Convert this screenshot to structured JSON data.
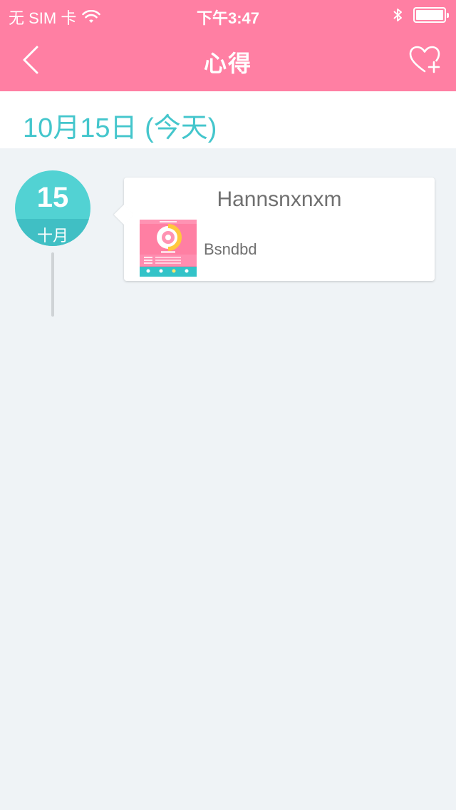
{
  "status": {
    "carrier": "无 SIM 卡",
    "time": "下午3:47"
  },
  "nav": {
    "title": "心得",
    "back_icon": "chevron-left-icon",
    "action_icon": "heart-plus-icon"
  },
  "date_header": {
    "text": "10月15日 (今天)"
  },
  "timeline": {
    "day": "15",
    "month": "十月"
  },
  "entry": {
    "title": "Hannsnxnxm",
    "text": "Bsndbd"
  },
  "colors": {
    "primary_pink": "#ff7fa3",
    "accent_teal": "#44c6cc",
    "background": "#eff3f6",
    "text_gray": "#707070"
  }
}
